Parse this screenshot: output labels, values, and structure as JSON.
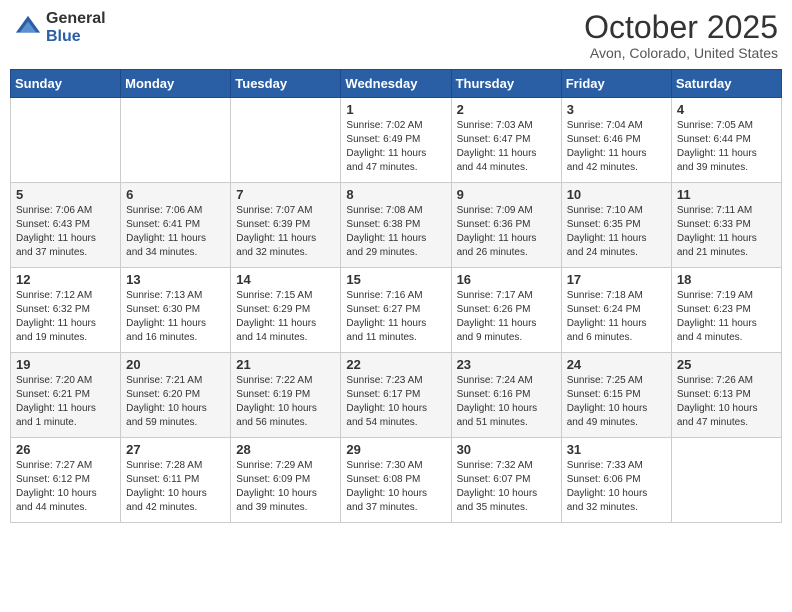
{
  "header": {
    "logo_general": "General",
    "logo_blue": "Blue",
    "month_title": "October 2025",
    "location": "Avon, Colorado, United States"
  },
  "days_of_week": [
    "Sunday",
    "Monday",
    "Tuesday",
    "Wednesday",
    "Thursday",
    "Friday",
    "Saturday"
  ],
  "weeks": [
    [
      {
        "day": "",
        "info": ""
      },
      {
        "day": "",
        "info": ""
      },
      {
        "day": "",
        "info": ""
      },
      {
        "day": "1",
        "info": "Sunrise: 7:02 AM\nSunset: 6:49 PM\nDaylight: 11 hours and 47 minutes."
      },
      {
        "day": "2",
        "info": "Sunrise: 7:03 AM\nSunset: 6:47 PM\nDaylight: 11 hours and 44 minutes."
      },
      {
        "day": "3",
        "info": "Sunrise: 7:04 AM\nSunset: 6:46 PM\nDaylight: 11 hours and 42 minutes."
      },
      {
        "day": "4",
        "info": "Sunrise: 7:05 AM\nSunset: 6:44 PM\nDaylight: 11 hours and 39 minutes."
      }
    ],
    [
      {
        "day": "5",
        "info": "Sunrise: 7:06 AM\nSunset: 6:43 PM\nDaylight: 11 hours and 37 minutes."
      },
      {
        "day": "6",
        "info": "Sunrise: 7:06 AM\nSunset: 6:41 PM\nDaylight: 11 hours and 34 minutes."
      },
      {
        "day": "7",
        "info": "Sunrise: 7:07 AM\nSunset: 6:39 PM\nDaylight: 11 hours and 32 minutes."
      },
      {
        "day": "8",
        "info": "Sunrise: 7:08 AM\nSunset: 6:38 PM\nDaylight: 11 hours and 29 minutes."
      },
      {
        "day": "9",
        "info": "Sunrise: 7:09 AM\nSunset: 6:36 PM\nDaylight: 11 hours and 26 minutes."
      },
      {
        "day": "10",
        "info": "Sunrise: 7:10 AM\nSunset: 6:35 PM\nDaylight: 11 hours and 24 minutes."
      },
      {
        "day": "11",
        "info": "Sunrise: 7:11 AM\nSunset: 6:33 PM\nDaylight: 11 hours and 21 minutes."
      }
    ],
    [
      {
        "day": "12",
        "info": "Sunrise: 7:12 AM\nSunset: 6:32 PM\nDaylight: 11 hours and 19 minutes."
      },
      {
        "day": "13",
        "info": "Sunrise: 7:13 AM\nSunset: 6:30 PM\nDaylight: 11 hours and 16 minutes."
      },
      {
        "day": "14",
        "info": "Sunrise: 7:15 AM\nSunset: 6:29 PM\nDaylight: 11 hours and 14 minutes."
      },
      {
        "day": "15",
        "info": "Sunrise: 7:16 AM\nSunset: 6:27 PM\nDaylight: 11 hours and 11 minutes."
      },
      {
        "day": "16",
        "info": "Sunrise: 7:17 AM\nSunset: 6:26 PM\nDaylight: 11 hours and 9 minutes."
      },
      {
        "day": "17",
        "info": "Sunrise: 7:18 AM\nSunset: 6:24 PM\nDaylight: 11 hours and 6 minutes."
      },
      {
        "day": "18",
        "info": "Sunrise: 7:19 AM\nSunset: 6:23 PM\nDaylight: 11 hours and 4 minutes."
      }
    ],
    [
      {
        "day": "19",
        "info": "Sunrise: 7:20 AM\nSunset: 6:21 PM\nDaylight: 11 hours and 1 minute."
      },
      {
        "day": "20",
        "info": "Sunrise: 7:21 AM\nSunset: 6:20 PM\nDaylight: 10 hours and 59 minutes."
      },
      {
        "day": "21",
        "info": "Sunrise: 7:22 AM\nSunset: 6:19 PM\nDaylight: 10 hours and 56 minutes."
      },
      {
        "day": "22",
        "info": "Sunrise: 7:23 AM\nSunset: 6:17 PM\nDaylight: 10 hours and 54 minutes."
      },
      {
        "day": "23",
        "info": "Sunrise: 7:24 AM\nSunset: 6:16 PM\nDaylight: 10 hours and 51 minutes."
      },
      {
        "day": "24",
        "info": "Sunrise: 7:25 AM\nSunset: 6:15 PM\nDaylight: 10 hours and 49 minutes."
      },
      {
        "day": "25",
        "info": "Sunrise: 7:26 AM\nSunset: 6:13 PM\nDaylight: 10 hours and 47 minutes."
      }
    ],
    [
      {
        "day": "26",
        "info": "Sunrise: 7:27 AM\nSunset: 6:12 PM\nDaylight: 10 hours and 44 minutes."
      },
      {
        "day": "27",
        "info": "Sunrise: 7:28 AM\nSunset: 6:11 PM\nDaylight: 10 hours and 42 minutes."
      },
      {
        "day": "28",
        "info": "Sunrise: 7:29 AM\nSunset: 6:09 PM\nDaylight: 10 hours and 39 minutes."
      },
      {
        "day": "29",
        "info": "Sunrise: 7:30 AM\nSunset: 6:08 PM\nDaylight: 10 hours and 37 minutes."
      },
      {
        "day": "30",
        "info": "Sunrise: 7:32 AM\nSunset: 6:07 PM\nDaylight: 10 hours and 35 minutes."
      },
      {
        "day": "31",
        "info": "Sunrise: 7:33 AM\nSunset: 6:06 PM\nDaylight: 10 hours and 32 minutes."
      },
      {
        "day": "",
        "info": ""
      }
    ]
  ]
}
